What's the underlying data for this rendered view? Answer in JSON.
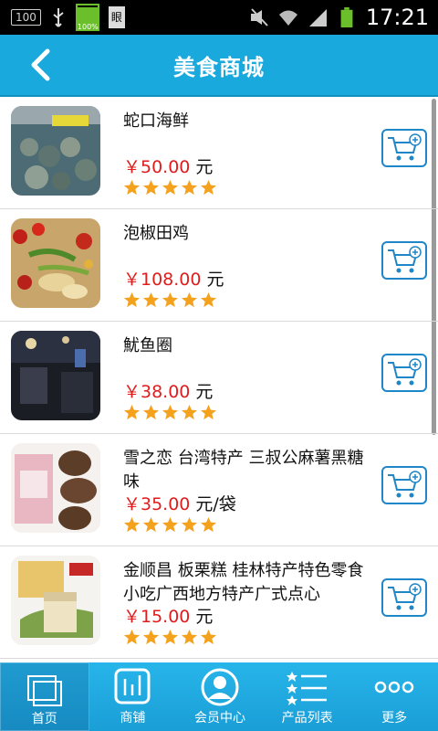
{
  "status_bar": {
    "badge": "100",
    "battery_small_label": "100%",
    "doc_char": "眼",
    "time": "17:21"
  },
  "header": {
    "title": "美食商城",
    "back_icon": "chevron-left-icon"
  },
  "products": [
    {
      "name": "蛇口海鲜",
      "price": "￥50.00",
      "unit": "元",
      "rating": 5
    },
    {
      "name": "泡椒田鸡",
      "price": "￥108.00",
      "unit": "元",
      "rating": 5
    },
    {
      "name": "魷鱼圈",
      "price": "￥38.00",
      "unit": "元",
      "rating": 5
    },
    {
      "name": "雪之恋 台湾特产 三叔公麻薯黑糖味",
      "price": "￥35.00",
      "unit": "元/袋",
      "rating": 5
    },
    {
      "name": "金顺昌 板栗糕 桂林特产特色零食小吃广西地方特产广式点心",
      "price": "￥15.00",
      "unit": "元",
      "rating": 5
    }
  ],
  "nav": [
    {
      "label": "首页",
      "icon": "home-icon",
      "active": true
    },
    {
      "label": "商铺",
      "icon": "shop-icon",
      "active": false
    },
    {
      "label": "会员中心",
      "icon": "member-icon",
      "active": false
    },
    {
      "label": "产品列表",
      "icon": "product-list-icon",
      "active": false
    },
    {
      "label": "更多",
      "icon": "more-icon",
      "active": false
    }
  ],
  "colors": {
    "header": "#19a9dc",
    "price": "#e01c1c",
    "cart_border": "#1f86c8",
    "star": "#f4a21e"
  }
}
